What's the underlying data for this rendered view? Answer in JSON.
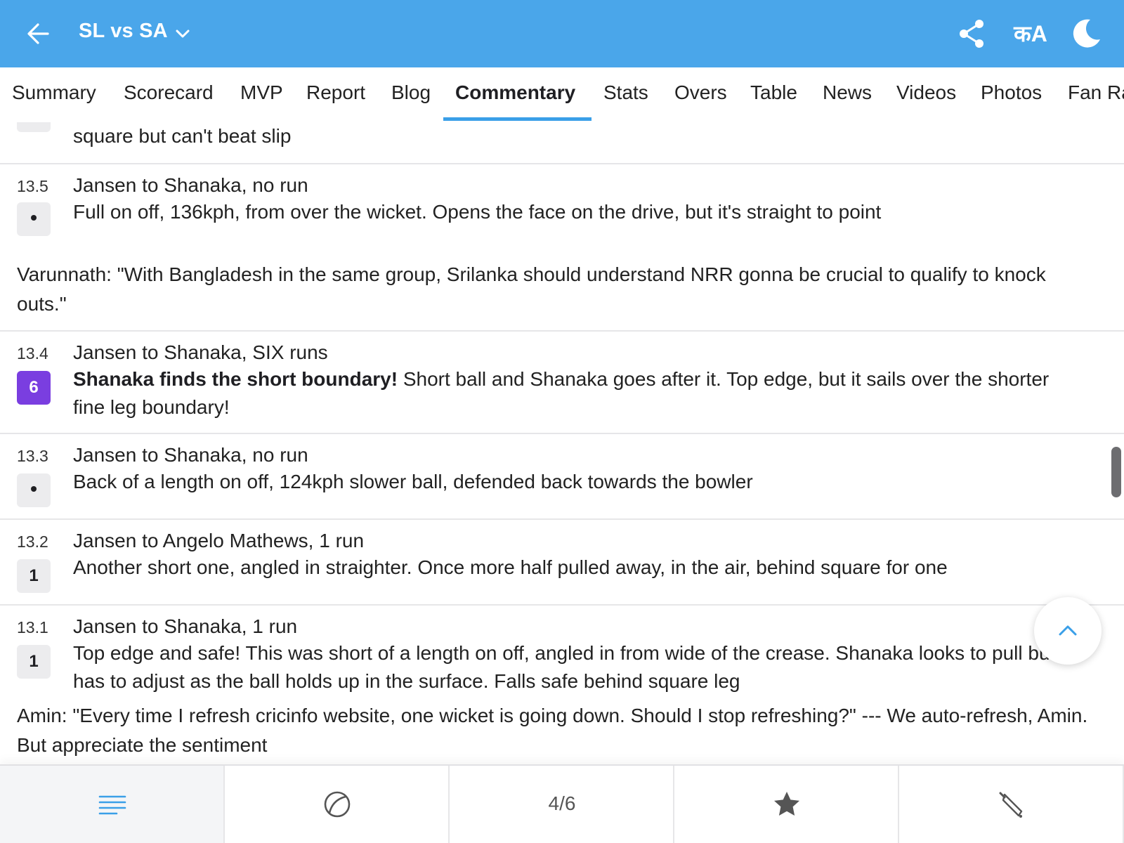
{
  "header": {
    "title": "SL vs SA",
    "lang_label": "कA",
    "colors": {
      "bar": "#4aa6ea",
      "accent": "#3a9fe8",
      "six_badge": "#7a3ee0"
    }
  },
  "tabs": [
    {
      "label": "Summary"
    },
    {
      "label": "Scorecard"
    },
    {
      "label": "MVP"
    },
    {
      "label": "Report"
    },
    {
      "label": "Blog"
    },
    {
      "label": "Commentary",
      "active": true
    },
    {
      "label": "Stats"
    },
    {
      "label": "Overs"
    },
    {
      "label": "Table"
    },
    {
      "label": "News"
    },
    {
      "label": "Videos"
    },
    {
      "label": "Photos"
    },
    {
      "label": "Fan Ra"
    }
  ],
  "commentary": {
    "partial_top": "square but can't beat slip",
    "balls": [
      {
        "over": "13.5",
        "badge": "•",
        "headline": "Jansen to Shanaka, no run",
        "text": "Full on off, 136kph, from over the wicket. Opens the face on the drive, but it's straight to point"
      },
      {
        "over": "13.4",
        "badge": "6",
        "headline": "Jansen to Shanaka, SIX runs",
        "bold": "Shanaka finds the short boundary!",
        "text": " Short ball and Shanaka goes after it. Top edge, but it sails over the shorter fine leg boundary!"
      },
      {
        "over": "13.3",
        "badge": "•",
        "headline": "Jansen to Shanaka, no run",
        "text": "Back of a length on off, 124kph slower ball, defended back towards the bowler"
      },
      {
        "over": "13.2",
        "badge": "1",
        "headline": "Jansen to Angelo Mathews, 1 run",
        "text": "Another short one, angled in straighter. Once more half pulled away, in the air, behind square for one"
      },
      {
        "over": "13.1",
        "badge": "1",
        "headline": "Jansen to Shanaka, 1 run",
        "text": "Top edge and safe! This was short of a length on off, angled in from wide of the crease. Shanaka looks to pull but has to adjust as the ball holds up in the surface. Falls safe behind square leg"
      }
    ],
    "fan_comments": [
      "Varunnath: \"With Bangladesh in the same group, Srilanka should understand NRR gonna be crucial to qualify to knock outs.\"",
      "Amin: \"Every time I refresh cricinfo website, one wicket is going down. Should I stop refreshing?\" --- We auto-refresh, Amin. But appreciate the sentiment"
    ]
  },
  "bottom_nav": {
    "items": [
      {
        "icon": "menu-lines-icon",
        "active": true
      },
      {
        "icon": "ball-icon"
      },
      {
        "label": "4/6"
      },
      {
        "icon": "star-icon"
      },
      {
        "icon": "bat-icon"
      }
    ]
  }
}
